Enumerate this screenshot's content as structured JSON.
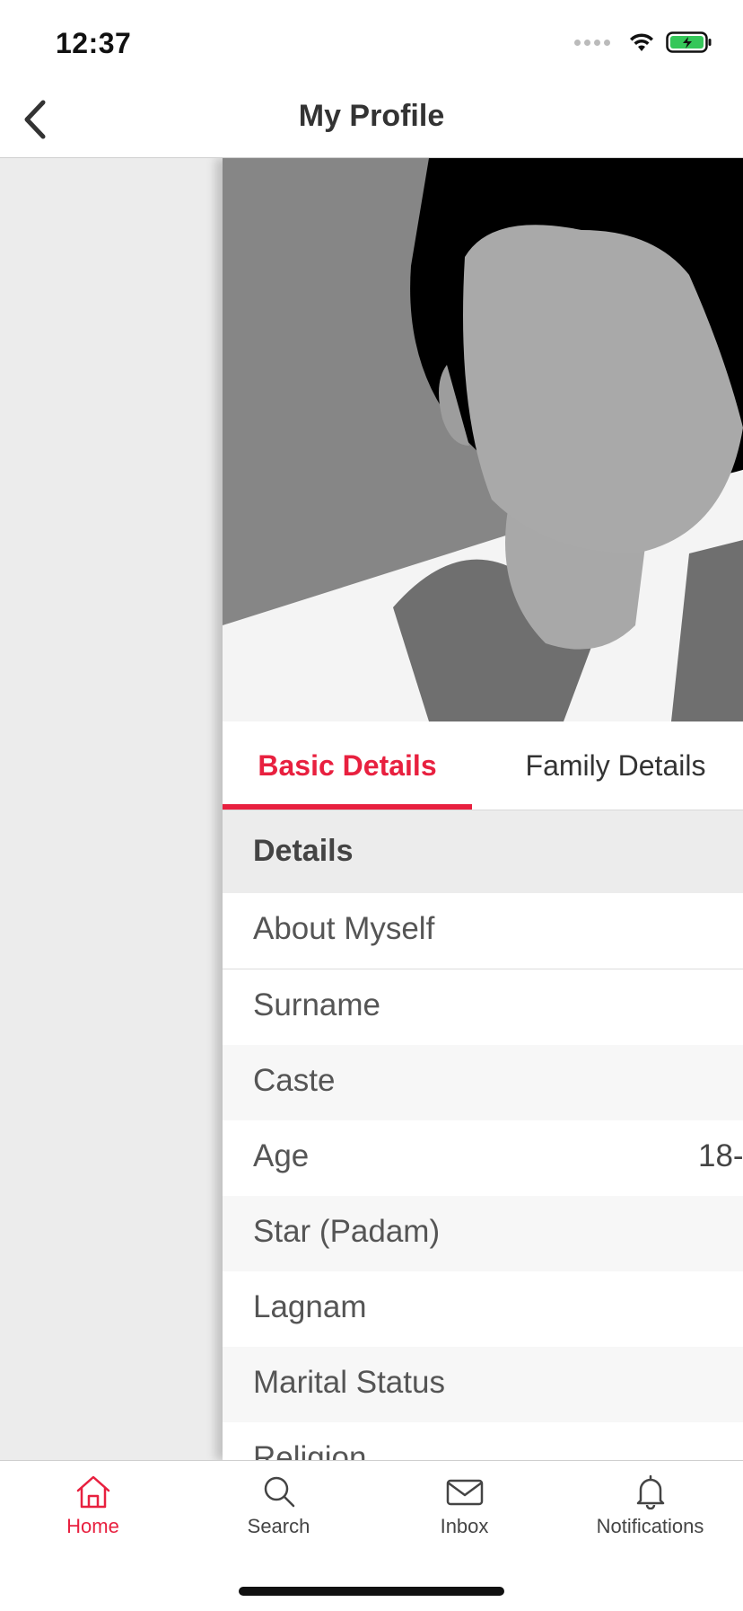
{
  "status_bar": {
    "time": "12:37"
  },
  "nav": {
    "title": "My Profile"
  },
  "tabs": [
    {
      "label": "Basic Details",
      "active": true
    },
    {
      "label": "Family Details",
      "active": false
    }
  ],
  "section": {
    "title": "Details"
  },
  "details": [
    {
      "label": "About Myself",
      "value": ""
    },
    {
      "label": "Surname",
      "value": ""
    },
    {
      "label": "Caste",
      "value": ""
    },
    {
      "label": "Age",
      "value": "18-"
    },
    {
      "label": "Star (Padam)",
      "value": ""
    },
    {
      "label": "Lagnam",
      "value": ""
    },
    {
      "label": "Marital Status",
      "value": ""
    },
    {
      "label": "Religion",
      "value": ""
    }
  ],
  "bottom_nav": [
    {
      "label": "Home",
      "icon": "home-icon",
      "active": true
    },
    {
      "label": "Search",
      "icon": "search-icon",
      "active": false
    },
    {
      "label": "Inbox",
      "icon": "mail-icon",
      "active": false
    },
    {
      "label": "Notifications",
      "icon": "bell-icon",
      "active": false
    }
  ],
  "colors": {
    "accent": "#e8203f",
    "battery": "#34c759"
  }
}
